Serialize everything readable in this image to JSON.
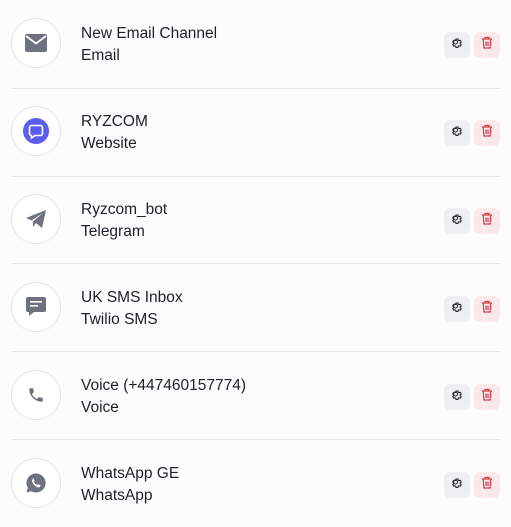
{
  "channels": [
    {
      "name": "New Email Channel",
      "type": "Email",
      "icon": "envelope-icon"
    },
    {
      "name": "RYZCOM",
      "type": "Website",
      "icon": "chat-bubble-icon"
    },
    {
      "name": "Ryzcom_bot",
      "type": "Telegram",
      "icon": "telegram-plane-icon"
    },
    {
      "name": "UK SMS Inbox",
      "type": "Twilio SMS",
      "icon": "sms-message-icon"
    },
    {
      "name": "Voice (+447460157774)",
      "type": "Voice",
      "icon": "phone-icon"
    },
    {
      "name": "WhatsApp GE",
      "type": "WhatsApp",
      "icon": "whatsapp-icon"
    }
  ],
  "colors": {
    "icon_gray": "#6d7180",
    "website_accent": "#5b5cf0",
    "delete_red": "#d23a4e",
    "settings_dark": "#2a2d33"
  }
}
